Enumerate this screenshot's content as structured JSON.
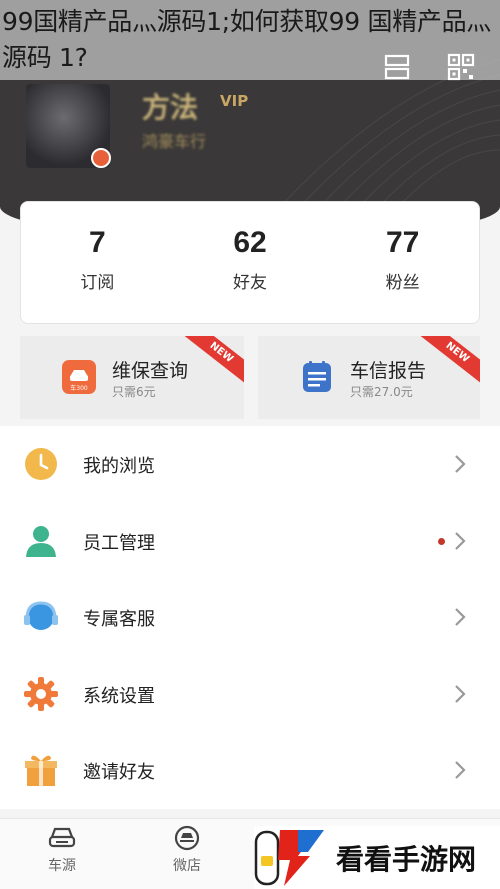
{
  "caption": {
    "line1": "99国精产品灬源码1;如何获取99 国精产品灬",
    "line2": "源码 1?"
  },
  "profile": {
    "name": "方法",
    "vip": "VIP",
    "company": "鸿豪车行"
  },
  "stats": [
    {
      "value": "7",
      "label": "订阅"
    },
    {
      "value": "62",
      "label": "好友"
    },
    {
      "value": "77",
      "label": "粉丝"
    }
  ],
  "features": [
    {
      "title": "维保查询",
      "sub": "只需6元",
      "badge": "NEW",
      "icon": "car-check-icon",
      "icon_text": "车300",
      "color": "#ef6a3c"
    },
    {
      "title": "车信报告",
      "sub": "只需27.0元",
      "badge": "NEW",
      "icon": "calendar-report-icon",
      "color": "#3d73c9"
    }
  ],
  "menu": [
    {
      "label": "我的浏览",
      "icon": "clock-icon",
      "color": "#f2b84b"
    },
    {
      "label": "员工管理",
      "icon": "person-icon",
      "color": "#3db38e",
      "dot": true
    },
    {
      "label": "专属客服",
      "icon": "headset-icon",
      "color": "#3a96e0"
    },
    {
      "label": "系统设置",
      "icon": "gear-icon",
      "color": "#ef7a3a"
    },
    {
      "label": "邀请好友",
      "icon": "gift-icon",
      "color": "#f0a03c"
    }
  ],
  "tabs": [
    {
      "label": "车源",
      "icon": "car-icon"
    },
    {
      "label": "微店",
      "icon": "store-icon"
    }
  ],
  "watermark": {
    "text": "看看手游网"
  }
}
